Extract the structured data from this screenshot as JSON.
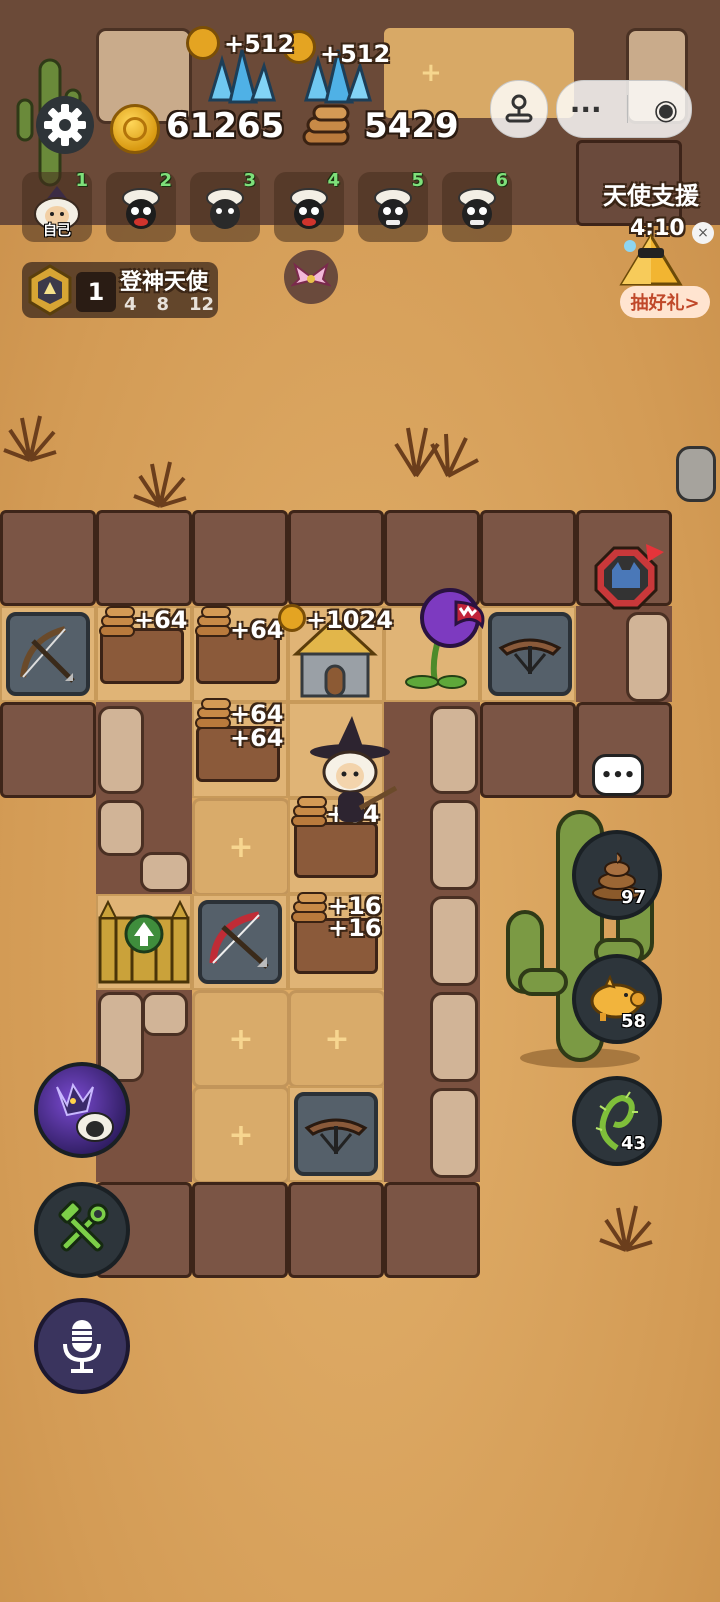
{
  "top_floating": {
    "gain_a": "+512",
    "gain_b": "+512"
  },
  "resources": {
    "gold": "61265",
    "wood": "5429",
    "gold_icon": "gold-coin-icon",
    "wood_icon": "wood-logs-icon"
  },
  "capsule": {
    "more": "···",
    "record": "◉"
  },
  "players": [
    {
      "rank": "1",
      "label": "自己"
    },
    {
      "rank": "2"
    },
    {
      "rank": "3"
    },
    {
      "rank": "4"
    },
    {
      "rank": "5"
    },
    {
      "rank": "6"
    }
  ],
  "rank_badge": {
    "level": "1",
    "title": "登神天使",
    "steps": [
      "4",
      "8",
      "12"
    ]
  },
  "event": {
    "title": "天使支援",
    "timer": "4:10",
    "button": "抽好礼>",
    "close": "×"
  },
  "board_labels": {
    "wood1": "+64",
    "wood2": "+64",
    "gold_big": "+1024",
    "wood3a": "+64",
    "wood3b": "+64",
    "player_wood": "+64",
    "wood4a": "+16",
    "wood4b": "+16",
    "empty_plus": "+"
  },
  "chat_icon": "•••",
  "side_buttons": [
    {
      "name": "poop",
      "count": "97"
    },
    {
      "name": "piggy-bank",
      "count": "58"
    },
    {
      "name": "thorn-vine",
      "count": "43"
    }
  ],
  "colors": {
    "accent_green": "#7ee07a",
    "event_button_text": "#c0482a"
  }
}
